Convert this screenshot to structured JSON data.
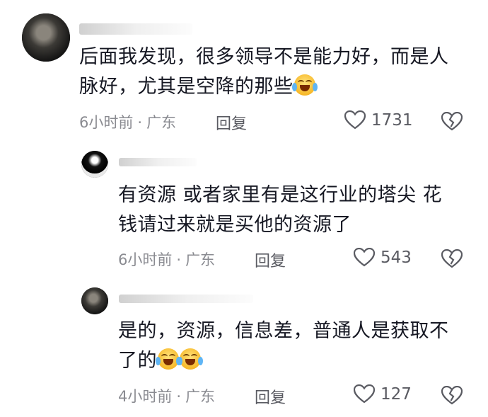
{
  "comments": [
    {
      "text": "后面我发现，很多领导不是能力好，而是人脉好，尤其是空降的那些",
      "line1": "后面我发现，很多领导不是能力好，而是人",
      "line2": "脉好，尤其是空降的那些",
      "emoji_count": 1,
      "time": "6小时前",
      "location": "广东",
      "reply_label": "回复",
      "likes": "1731"
    },
    {
      "text": "有资源 或者家里有是这行业的塔尖 花钱请过来就是买他的资源了",
      "line1": "有资源 或者家里有是这行业的塔尖 花",
      "line2": "钱请过来就是买他的资源了",
      "emoji_count": 0,
      "time": "6小时前",
      "location": "广东",
      "reply_label": "回复",
      "likes": "543"
    },
    {
      "text": "是的，资源，信息差，普通人是获取不了的",
      "line1": "是的，资源，信息差，普通人是获取不",
      "line2": "了的",
      "emoji_count": 2,
      "time": "4小时前",
      "location": "广东",
      "reply_label": "回复",
      "likes": "127"
    }
  ],
  "meta_separator": "·",
  "icons": {
    "like": "heart-outline-icon",
    "dislike": "broken-heart-icon",
    "emoji": "laughing-crying-emoji"
  },
  "colors": {
    "text": "#161823",
    "meta": "#8a8b91",
    "icon": "#5a5b62"
  }
}
